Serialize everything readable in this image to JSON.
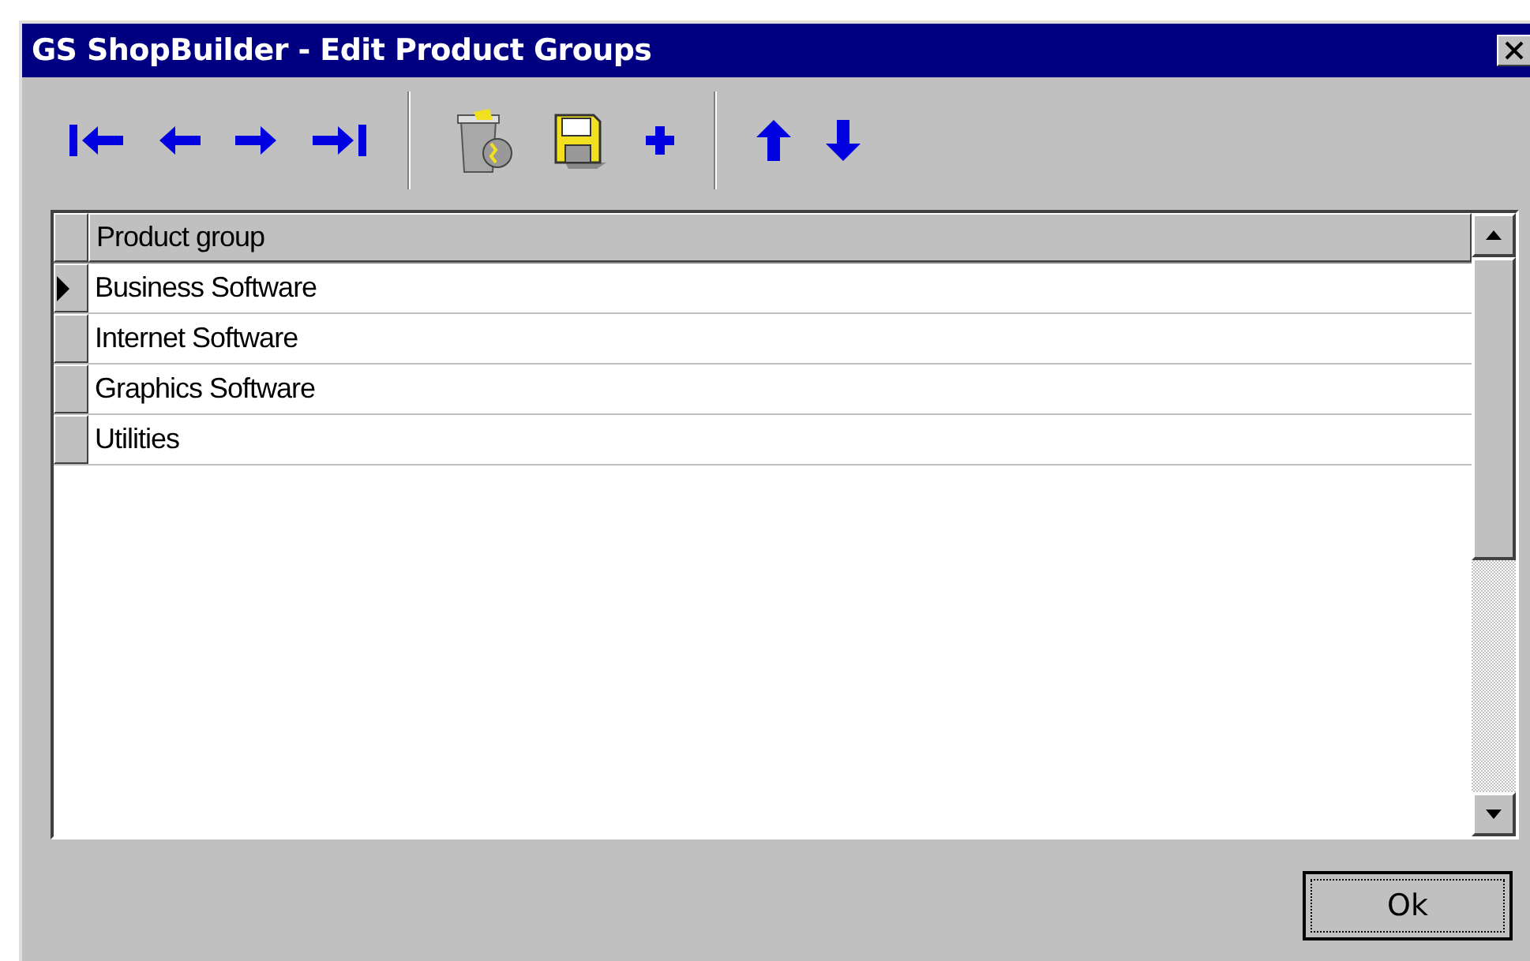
{
  "window": {
    "title": "GS ShopBuilder - Edit Product Groups"
  },
  "toolbar": [
    {
      "kind": "first"
    },
    {
      "kind": "prev"
    },
    {
      "kind": "next"
    },
    {
      "kind": "last"
    },
    {
      "kind": "separator"
    },
    {
      "kind": "delete"
    },
    {
      "kind": "save"
    },
    {
      "kind": "add"
    },
    {
      "kind": "separator"
    },
    {
      "kind": "up"
    },
    {
      "kind": "down"
    }
  ],
  "table": {
    "columns": [
      "Product group"
    ],
    "rows": [
      {
        "cells": [
          "Business Software"
        ],
        "selected": true
      },
      {
        "cells": [
          "Internet Software"
        ],
        "selected": false
      },
      {
        "cells": [
          "Graphics Software"
        ],
        "selected": false
      },
      {
        "cells": [
          "Utilities"
        ],
        "selected": false
      }
    ]
  },
  "buttons": [
    "Ok"
  ]
}
